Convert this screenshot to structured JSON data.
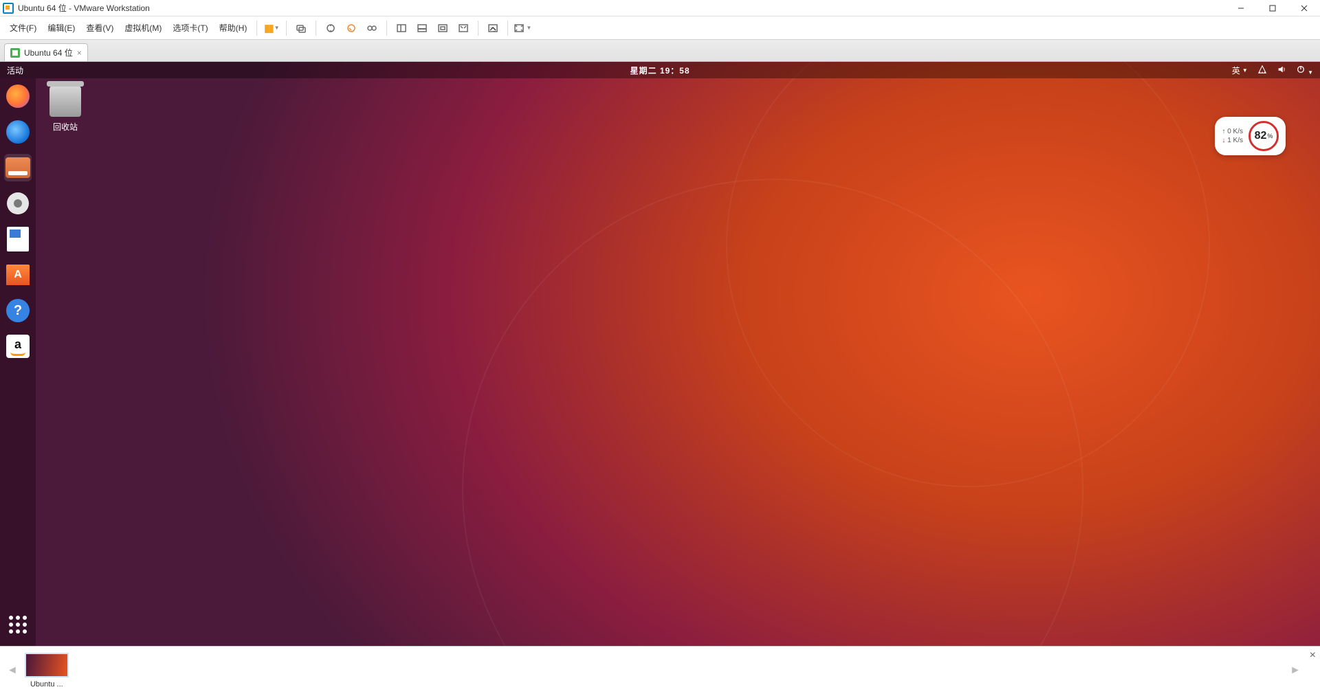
{
  "window": {
    "title": "Ubuntu 64 位 - VMware Workstation"
  },
  "menubar": {
    "items": [
      "文件(F)",
      "编辑(E)",
      "查看(V)",
      "虚拟机(M)",
      "选项卡(T)",
      "帮助(H)"
    ]
  },
  "vm_tab": {
    "label": "Ubuntu 64 位"
  },
  "ubuntu_topbar": {
    "activities": "活动",
    "clock": "星期二 19：58",
    "lang": "英"
  },
  "desktop": {
    "trash_label": "回收站"
  },
  "net_widget": {
    "up": "0  K/s",
    "down": "1  K/s",
    "gauge_value": "82",
    "gauge_unit": "%"
  },
  "thumb": {
    "label": "Ubuntu ..."
  }
}
